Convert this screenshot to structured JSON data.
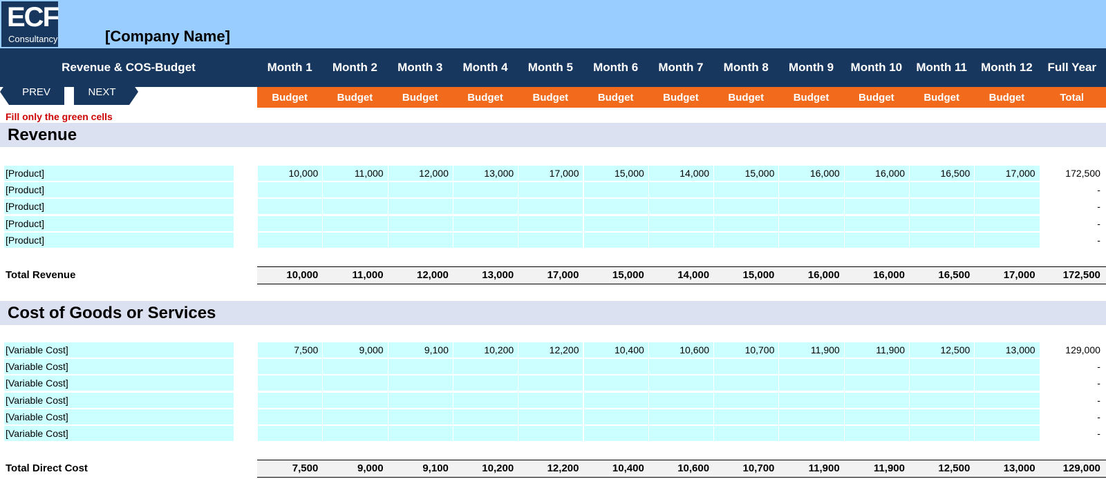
{
  "logo": {
    "main": "ECF",
    "sub": "Consultancy"
  },
  "company_name": "[Company Name]",
  "sheet_title": "Revenue & COS-Budget",
  "columns": [
    "Month 1",
    "Month 2",
    "Month 3",
    "Month 4",
    "Month 5",
    "Month 6",
    "Month 7",
    "Month 8",
    "Month 9",
    "Month 10",
    "Month 11",
    "Month 12",
    "Full Year"
  ],
  "subheaders": [
    "Budget",
    "Budget",
    "Budget",
    "Budget",
    "Budget",
    "Budget",
    "Budget",
    "Budget",
    "Budget",
    "Budget",
    "Budget",
    "Budget",
    "Total"
  ],
  "nav": {
    "prev": "PREV",
    "next": "NEXT"
  },
  "note": "Fill only the green cells",
  "colors": {
    "header_navy": "#17375e",
    "top_band": "#99ccff",
    "subheader_orange": "#f26b1d",
    "input_cell": "#ccffff",
    "section_band": "#dce1f2",
    "note_red": "#cc0000"
  },
  "revenue": {
    "title": "Revenue",
    "rows": [
      {
        "label": "[Product]",
        "values": [
          "10,000",
          "11,000",
          "12,000",
          "13,000",
          "17,000",
          "15,000",
          "14,000",
          "15,000",
          "16,000",
          "16,000",
          "16,500",
          "17,000"
        ],
        "total": "172,500"
      },
      {
        "label": "[Product]",
        "values": [
          "",
          "",
          "",
          "",
          "",
          "",
          "",
          "",
          "",
          "",
          "",
          ""
        ],
        "total": "-"
      },
      {
        "label": "[Product]",
        "values": [
          "",
          "",
          "",
          "",
          "",
          "",
          "",
          "",
          "",
          "",
          "",
          ""
        ],
        "total": "-"
      },
      {
        "label": "[Product]",
        "values": [
          "",
          "",
          "",
          "",
          "",
          "",
          "",
          "",
          "",
          "",
          "",
          ""
        ],
        "total": "-"
      },
      {
        "label": "[Product]",
        "values": [
          "",
          "",
          "",
          "",
          "",
          "",
          "",
          "",
          "",
          "",
          "",
          ""
        ],
        "total": "-"
      }
    ],
    "total_label": "Total Revenue",
    "totals": [
      "10,000",
      "11,000",
      "12,000",
      "13,000",
      "17,000",
      "15,000",
      "14,000",
      "15,000",
      "16,000",
      "16,000",
      "16,500",
      "17,000",
      "172,500"
    ]
  },
  "cos": {
    "title": "Cost of Goods or Services",
    "rows": [
      {
        "label": "[Variable Cost]",
        "values": [
          "7,500",
          "9,000",
          "9,100",
          "10,200",
          "12,200",
          "10,400",
          "10,600",
          "10,700",
          "11,900",
          "11,900",
          "12,500",
          "13,000"
        ],
        "total": "129,000"
      },
      {
        "label": "[Variable Cost]",
        "values": [
          "",
          "",
          "",
          "",
          "",
          "",
          "",
          "",
          "",
          "",
          "",
          ""
        ],
        "total": "-"
      },
      {
        "label": "[Variable Cost]",
        "values": [
          "",
          "",
          "",
          "",
          "",
          "",
          "",
          "",
          "",
          "",
          "",
          ""
        ],
        "total": "-"
      },
      {
        "label": "[Variable Cost]",
        "values": [
          "",
          "",
          "",
          "",
          "",
          "",
          "",
          "",
          "",
          "",
          "",
          ""
        ],
        "total": "-"
      },
      {
        "label": "[Variable Cost]",
        "values": [
          "",
          "",
          "",
          "",
          "",
          "",
          "",
          "",
          "",
          "",
          "",
          ""
        ],
        "total": "-"
      },
      {
        "label": "[Variable Cost]",
        "values": [
          "",
          "",
          "",
          "",
          "",
          "",
          "",
          "",
          "",
          "",
          "",
          ""
        ],
        "total": "-"
      }
    ],
    "total_label": "Total Direct Cost",
    "totals": [
      "7,500",
      "9,000",
      "9,100",
      "10,200",
      "12,200",
      "10,400",
      "10,600",
      "10,700",
      "11,900",
      "11,900",
      "12,500",
      "13,000",
      "129,000"
    ]
  }
}
